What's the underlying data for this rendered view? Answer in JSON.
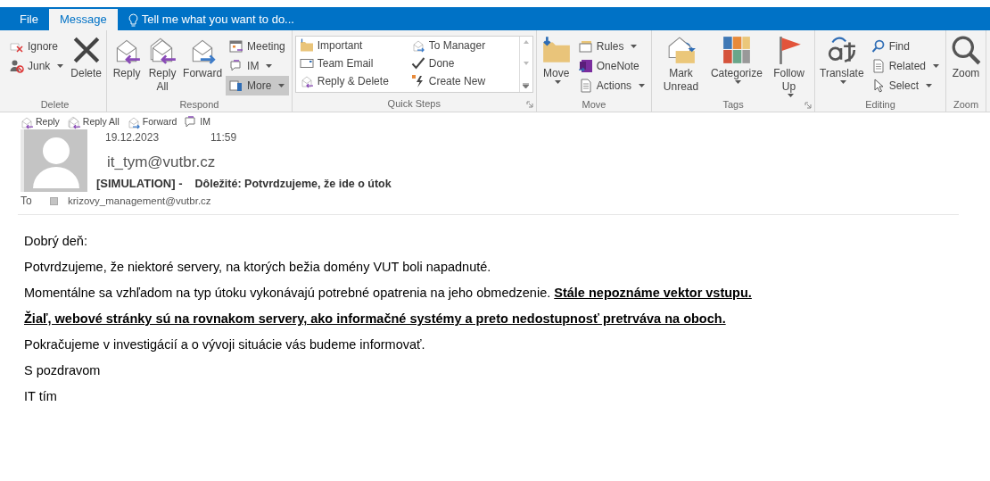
{
  "tabs": [
    {
      "label": "File",
      "selected": false
    },
    {
      "label": "Message",
      "selected": true
    }
  ],
  "tell_me": {
    "placeholder": "Tell me what you want to do..."
  },
  "ribbon": [
    {
      "label": "Delete",
      "launcher": false,
      "items": [
        {
          "label": "Ignore",
          "kind": "small",
          "dropdown": false
        },
        {
          "label": "Junk",
          "kind": "small",
          "dropdown": true
        },
        {
          "label": "Delete",
          "kind": "large",
          "dropdown": false
        }
      ]
    },
    {
      "label": "Respond",
      "launcher": false,
      "items": [
        {
          "label": "Reply",
          "kind": "large",
          "dropdown": false
        },
        {
          "label": "Reply All",
          "kind": "large",
          "dropdown": false
        },
        {
          "label": "Forward",
          "kind": "large",
          "dropdown": false
        },
        {
          "label": "Meeting",
          "kind": "small",
          "dropdown": false
        },
        {
          "label": "IM",
          "kind": "small",
          "dropdown": true
        },
        {
          "label": "More",
          "kind": "small",
          "dropdown": true,
          "highlighted": true
        }
      ]
    },
    {
      "label": "Quick Steps",
      "launcher": true,
      "items": [
        {
          "label": "Important",
          "kind": "gallery"
        },
        {
          "label": "Team Email",
          "kind": "gallery"
        },
        {
          "label": "Reply & Delete",
          "kind": "gallery"
        },
        {
          "label": "To Manager",
          "kind": "gallery"
        },
        {
          "label": "Done",
          "kind": "gallery"
        },
        {
          "label": "Create New",
          "kind": "gallery"
        }
      ]
    },
    {
      "label": "Move",
      "launcher": false,
      "items": [
        {
          "label": "Move",
          "kind": "large",
          "dropdown": true
        },
        {
          "label": "Rules",
          "kind": "small",
          "dropdown": true
        },
        {
          "label": "OneNote",
          "kind": "small",
          "dropdown": false
        },
        {
          "label": "Actions",
          "kind": "small",
          "dropdown": true
        }
      ]
    },
    {
      "label": "Tags",
      "launcher": true,
      "items": [
        {
          "label": "Mark Unread",
          "kind": "large",
          "dropdown": false
        },
        {
          "label": "Categorize",
          "kind": "large",
          "dropdown": true
        },
        {
          "label": "Follow Up",
          "kind": "large",
          "dropdown": true
        }
      ]
    },
    {
      "label": "Editing",
      "launcher": false,
      "items": [
        {
          "label": "Translate",
          "kind": "large",
          "dropdown": true
        },
        {
          "label": "Find",
          "kind": "small",
          "dropdown": false
        },
        {
          "label": "Related",
          "kind": "small",
          "dropdown": true
        },
        {
          "label": "Select",
          "kind": "small",
          "dropdown": true
        }
      ]
    },
    {
      "label": "Zoom",
      "launcher": false,
      "items": [
        {
          "label": "Zoom",
          "kind": "large",
          "dropdown": false
        }
      ]
    }
  ],
  "quick_actions": [
    "Reply",
    "Reply All",
    "Forward",
    "IM"
  ],
  "message": {
    "date": "19.12.2023",
    "time": "11:59",
    "sender": "it_tym@vutbr.cz",
    "subject_prefix": "[SIMULATION] -",
    "subject": "Dôležité: Potvrdzujeme, že ide o útok",
    "to_label": "To",
    "to": "krizovy_management@vutbr.cz"
  },
  "body": [
    [
      {
        "text": "Dobrý deň:",
        "kind": "plain"
      }
    ],
    [
      {
        "text": "Potvrdzujeme, že niektoré servery, na ktorých bežia domény VUT boli napadnuté.",
        "kind": "plain"
      }
    ],
    [
      {
        "text": "Momentálne sa vzhľadom na typ útoku vykonávajú potrebné opatrenia na jeho obmedzenie. ",
        "kind": "plain"
      },
      {
        "text": "Stále nepoznáme vektor vstupu.",
        "kind": "emphasis"
      }
    ],
    [
      {
        "text": "Žiaľ, webové stránky sú na rovnakom servery, ako informačné systémy a preto nedostupnosť pretrváva na oboch.",
        "kind": "emphasis"
      }
    ],
    [
      {
        "text": "Pokračujeme v investigácií a o vývoji situácie vás budeme informovať.",
        "kind": "plain"
      }
    ],
    [
      {
        "text": "S pozdravom",
        "kind": "plain"
      }
    ],
    [
      {
        "text": "IT tím",
        "kind": "plain"
      }
    ]
  ]
}
